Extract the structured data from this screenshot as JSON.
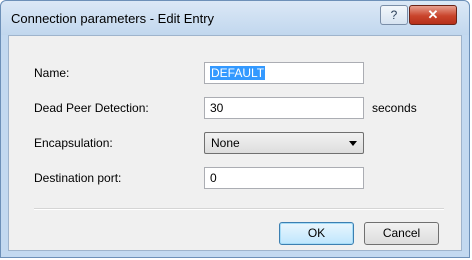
{
  "window": {
    "title": "Connection parameters - Edit Entry",
    "help_label": "?",
    "close_label": "✕"
  },
  "form": {
    "name_label": "Name:",
    "name_value": "DEFAULT",
    "dpd_label": "Dead Peer Detection:",
    "dpd_value": "30",
    "dpd_unit": "seconds",
    "encapsulation_label": "Encapsulation:",
    "encapsulation_value": "None",
    "destination_port_label": "Destination port:",
    "destination_port_value": "0"
  },
  "buttons": {
    "ok_label": "OK",
    "cancel_label": "Cancel"
  },
  "colors": {
    "selection": "#3399ff",
    "close_button": "#c9442c",
    "default_button_border": "#3c7fb1"
  }
}
